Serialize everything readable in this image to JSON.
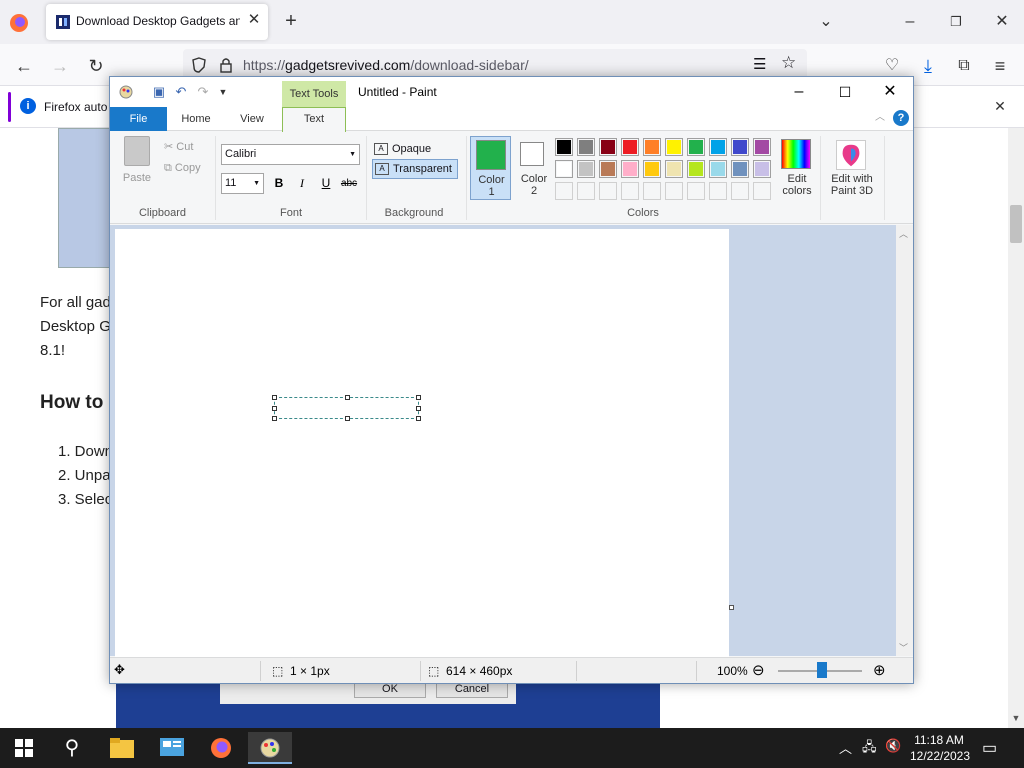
{
  "browser": {
    "tab": {
      "title": "Download Desktop Gadgets an",
      "close": "✕"
    },
    "new_tab": "+",
    "url": {
      "scheme": "https://",
      "host": "gadgetsrevived.com",
      "path": "/download-sidebar/"
    },
    "notification": {
      "text": "Firefox auto",
      "icon": "i",
      "close": "✕"
    }
  },
  "page": {
    "para": [
      "For all gad",
      "Desktop G",
      "8.1!"
    ],
    "heading": "How to",
    "steps": [
      "1. Down",
      "2. Unpa",
      "3. Selec"
    ],
    "dialog": {
      "ok": "OK",
      "cancel": "Cancel"
    }
  },
  "paint": {
    "title": "Untitled - Paint",
    "context_tab": "Text Tools",
    "tabs": {
      "file": "File",
      "home": "Home",
      "view": "View",
      "text": "Text"
    },
    "clipboard": {
      "paste": "Paste",
      "cut": "Cut",
      "copy": "Copy",
      "label": "Clipboard"
    },
    "font": {
      "family": "Calibri",
      "size": "11",
      "bold": "B",
      "italic": "I",
      "underline": "U",
      "strike": "abc",
      "label": "Font"
    },
    "background": {
      "opaque": "Opaque",
      "transparent": "Transparent",
      "label": "Background",
      "selected": "Transparent"
    },
    "colors": {
      "color1_label": "Color\n1",
      "color2_label": "Color\n2",
      "color1": "#22b14c",
      "color2": "#ffffff",
      "edit_colors": "Edit colors",
      "label": "Colors",
      "palette_row1": [
        "#000000",
        "#7f7f7f",
        "#880015",
        "#ed1c24",
        "#ff7f27",
        "#fff200",
        "#22b14c",
        "#00a2e8",
        "#3f48cc",
        "#a349a4"
      ],
      "palette_row2": [
        "#ffffff",
        "#c3c3c3",
        "#b97a57",
        "#ffaec9",
        "#ffc90e",
        "#efe4b0",
        "#b5e61d",
        "#99d9ea",
        "#7092be",
        "#c8bfe7"
      ],
      "palette_row3": [
        "",
        "",
        "",
        "",
        "",
        "",
        "",
        "",
        "",
        ""
      ]
    },
    "paint3d": "Edit with Paint 3D",
    "status": {
      "selection": "1 × 1px",
      "size": "614 × 460px",
      "zoom": "100%"
    }
  },
  "taskbar": {
    "time": "11:18 AM",
    "date": "12/22/2023"
  }
}
